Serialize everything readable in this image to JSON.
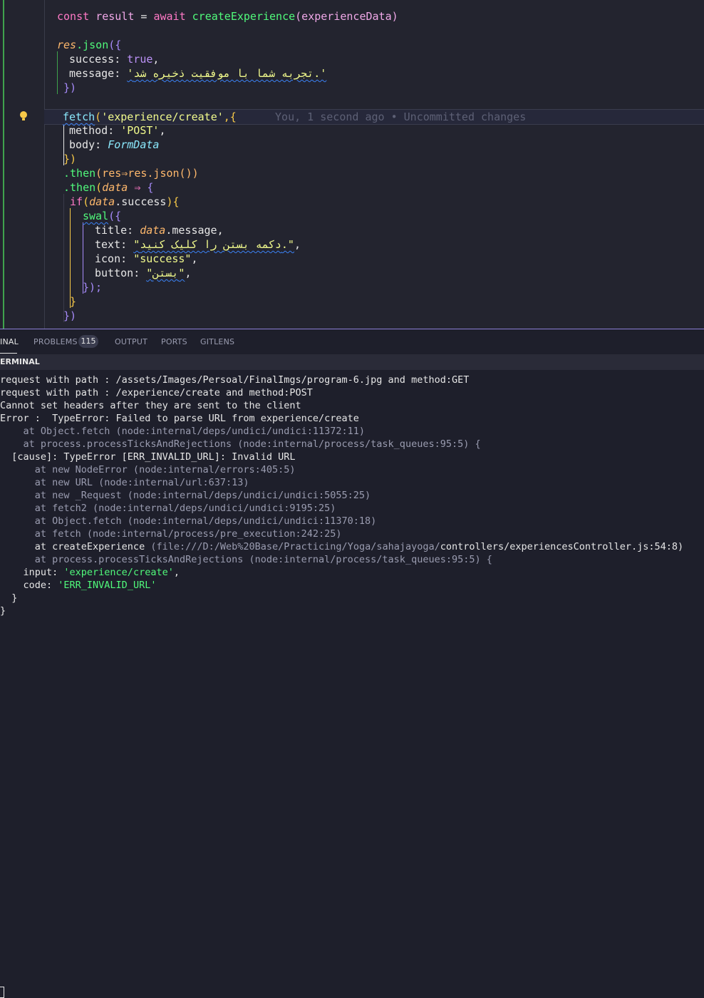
{
  "editor": {
    "lines": {
      "l1_kw1": "const",
      "l1_var": "result",
      "l1_eq": " = ",
      "l1_kw2": "await",
      "l1_fn": "createExperience",
      "l1_arg": "(experienceData)",
      "l2_obj": "res",
      "l2_method": ".json",
      "l2_open": "({",
      "l3_key": "success",
      "l3_val": "true",
      "l4_key": "message",
      "l4_val": "'تجربه شما با موفقیت ذخیره شد.'",
      "l5_close": "})",
      "l6_fn": "fetch",
      "l6_arg": "'experience/create'",
      "l6_rest": ",{",
      "l6_blame": "You, 1 second ago • Uncommitted changes",
      "l7_key": "method",
      "l7_val": "'POST'",
      "l8_key": "body",
      "l8_val": "FormData",
      "l9_close": "})",
      "l10_then": ".then",
      "l10_body": "(res⇒res.json())",
      "l11_then": ".then",
      "l11_param": "data",
      "l11_arrow": "⇒",
      "l12_if": "if",
      "l12_cond": "data",
      "l12_prop": ".success",
      "l13_fn": "swal",
      "l14_key": "title",
      "l14_val1": "data",
      "l14_val2": ".message,",
      "l15_key": "text",
      "l15_val": "\"دکمه بستن را کلیک کنید.\"",
      "l16_key": "icon",
      "l16_val": "\"success\"",
      "l17_key": "button",
      "l17_val": "\"بستن\"",
      "l18_close": "});",
      "l19_close": "}",
      "l20_close": "})"
    }
  },
  "panel": {
    "tabs": [
      "INAL",
      "PROBLEMS",
      "OUTPUT",
      "PORTS",
      "GITLENS"
    ],
    "problems_count": "115",
    "header": "ERMINAL"
  },
  "terminal": {
    "lines": [
      "request with path : /assets/Images/Persoal/FinalImgs/program-6.jpg and method:GET",
      "request with path : /experience/create and method:POST",
      "Cannot set headers after they are sent to the client",
      "Error :  TypeError: Failed to parse URL from experience/create",
      "    at Object.fetch (node:internal/deps/undici/undici:11372:11)",
      "    at process.processTicksAndRejections (node:internal/process/task_queues:95:5) {",
      "  [cause]: TypeError [ERR_INVALID_URL]: Invalid URL",
      "      at new NodeError (node:internal/errors:405:5)",
      "      at new URL (node:internal/url:637:13)",
      "      at new _Request (node:internal/deps/undici/undici:5055:25)",
      "      at fetch2 (node:internal/deps/undici/undici:9195:25)",
      "      at Object.fetch (node:internal/deps/undici/undici:11370:18)",
      "      at fetch (node:internal/process/pre_execution:242:25)",
      "      at createExperience",
      "(file:///D:/Web%20Base/Practicing/Yoga/sahajayoga/",
      "controllers/experiencesController.js:54:8)",
      "      at process.processTicksAndRejections (node:internal/process/task_queues:95:5) {",
      "    input: ",
      "'experience/create'",
      ",",
      "    code: ",
      "'ERR_INVALID_URL'",
      "  }",
      "}"
    ]
  }
}
